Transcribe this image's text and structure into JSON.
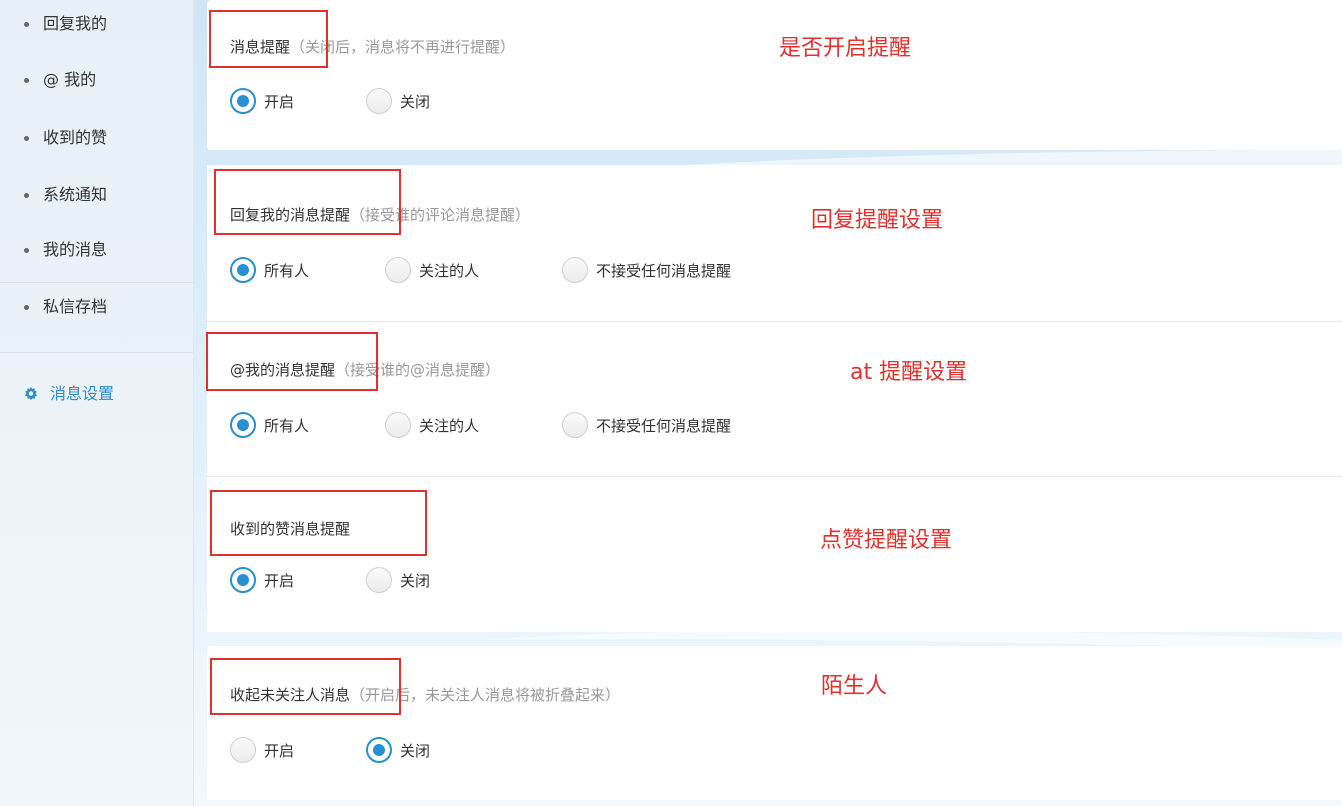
{
  "sidebar": {
    "items": [
      {
        "label": "回复我的"
      },
      {
        "label": "@ 我的"
      },
      {
        "label": "收到的赞"
      },
      {
        "label": "系统通知"
      },
      {
        "label": "我的消息"
      },
      {
        "label": "私信存档"
      }
    ],
    "active": {
      "label": "消息设置",
      "icon": "gear-icon"
    }
  },
  "settings": [
    {
      "title": "消息提醒",
      "desc": "（关闭后，消息将不再进行提醒）",
      "options": [
        "开启",
        "关闭"
      ],
      "selected": 0,
      "annotation": "是否开启提醒"
    },
    {
      "title": "回复我的消息提醒",
      "desc": "（接受谁的评论消息提醒）",
      "options": [
        "所有人",
        "关注的人",
        "不接受任何消息提醒"
      ],
      "selected": 0,
      "annotation": "回复提醒设置"
    },
    {
      "title": "@我的消息提醒",
      "desc": "（接受谁的@消息提醒）",
      "options": [
        "所有人",
        "关注的人",
        "不接受任何消息提醒"
      ],
      "selected": 0,
      "annotation": "at 提醒设置"
    },
    {
      "title": "收到的赞消息提醒",
      "desc": "",
      "options": [
        "开启",
        "关闭"
      ],
      "selected": 0,
      "annotation": "点赞提醒设置"
    },
    {
      "title": "收起未关注人消息",
      "desc": "（开启后，未关注人消息将被折叠起来）",
      "options": [
        "开启",
        "关闭"
      ],
      "selected": 1,
      "annotation": "陌生人"
    }
  ],
  "colors": {
    "accent": "#2a8fd0",
    "annotation": "#e0312f"
  }
}
